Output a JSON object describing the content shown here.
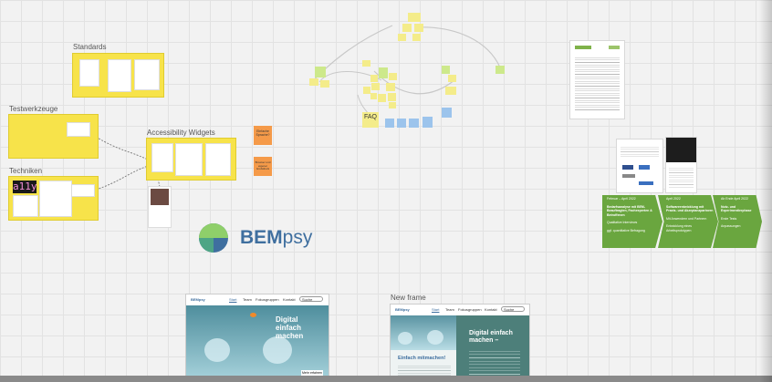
{
  "frames": {
    "standards": "Standards",
    "testwerkzeuge": "Testwerkzeuge",
    "techniken": "Techniken",
    "accessibility_widgets": "Accessibility Widgets",
    "new_frame": "New frame"
  },
  "techniken_graphic": "a11y",
  "orange_notes": [
    "Einfache Sprache?",
    "Browser und eigener Großdruck"
  ],
  "faq_note": "FAQ",
  "logo": {
    "brand": "BEM",
    "suffix": "psy"
  },
  "process": {
    "steps": [
      {
        "date": "Februar – April 2022",
        "title": "Bedarfsanalyse mit BEM-Beauftragten, Fachexperten & Betroffenen",
        "items": [
          "Qualitative Interviews",
          "ggf. quantitative Befragung"
        ]
      },
      {
        "date": "April 2022",
        "title": "Softwareentwicklung mit Praxis- und Akzeptanzpartnern",
        "items": [
          "Mit Anwendern und Partnern",
          "Entwicklung eines Arbeitsprototypen"
        ]
      },
      {
        "date": "Ab Ende April 2022",
        "title": "Nutz- und Experimentierphase",
        "items": [
          "Erste Tests",
          "Anpassungen"
        ]
      }
    ]
  },
  "website_1": {
    "logo": "BEMpsy",
    "nav": [
      "Start",
      "Team",
      "Fokusgruppen",
      "Kontakt"
    ],
    "search_placeholder": "Suche",
    "hero_title": "Digital einfach machen",
    "hero_button": "Mehr erfahren"
  },
  "website_2": {
    "logo": "BEMpsy",
    "nav": [
      "Start",
      "Team",
      "Fokusgruppen",
      "Kontakt"
    ],
    "search_placeholder": "Suche",
    "hero_title": "Digital einfach machen –",
    "hero_subtitle": "Einfach mitmachen!"
  },
  "colors": {
    "sticky_yellow": "#f7e34a",
    "process_green": "#6aa63f",
    "logo_text": "#3f6f9f",
    "orange_note": "#f59a49",
    "teal_site": "#4d7f7a"
  }
}
